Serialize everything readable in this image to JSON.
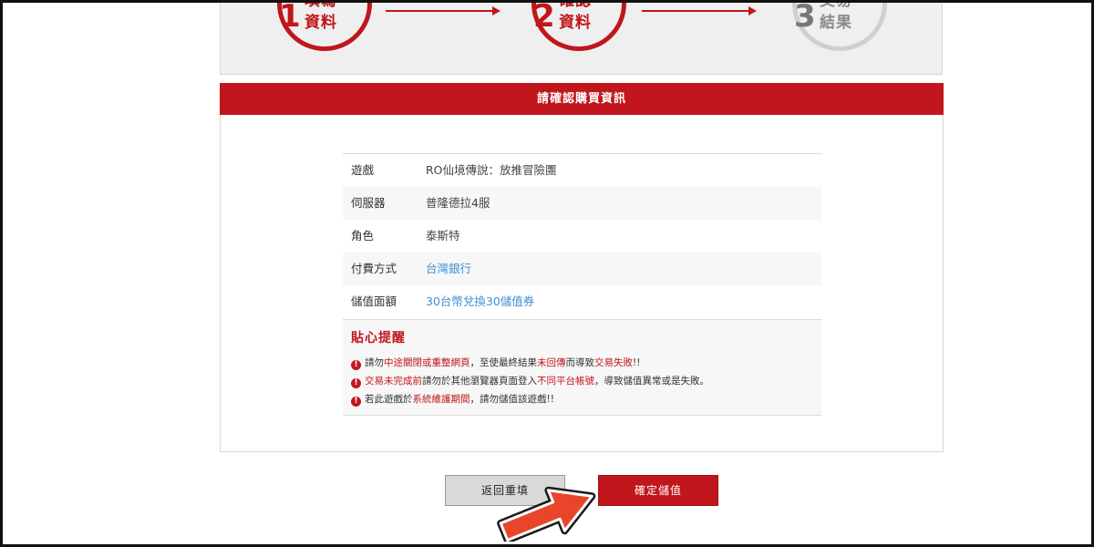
{
  "steps": [
    {
      "num": "1",
      "line1": "填寫",
      "line2": "資料",
      "state": "done"
    },
    {
      "num": "2",
      "line1": "確認",
      "line2": "資料",
      "state": "active"
    },
    {
      "num": "3",
      "line1": "交易",
      "line2": "結果",
      "state": "pending"
    }
  ],
  "panel": {
    "title": "請確認購買資訊",
    "rows": [
      {
        "label": "遊戲",
        "value": "RO仙境傳說：放推冒險團"
      },
      {
        "label": "伺服器",
        "value": "普隆德拉4服"
      },
      {
        "label": "角色",
        "value": "泰斯特"
      },
      {
        "label": "付費方式",
        "value": "台灣銀行"
      },
      {
        "label": "儲值面額",
        "value": "30台幣兌換30儲值券"
      }
    ],
    "tips": {
      "title": "貼心提醒",
      "items": [
        {
          "parts": [
            "請勿",
            "中途關閉或重整網頁",
            "，至使最終結果",
            "未回傳",
            "而導致",
            "交易失敗",
            "!!"
          ]
        },
        {
          "parts": [
            "交易未完成前",
            "請勿於其他瀏覽器頁面登入",
            "不同平台帳號",
            "，導致儲值異常或是失敗。"
          ]
        },
        {
          "parts": [
            "若此遊戲於",
            "系統維護期間",
            "，請勿儲值該遊戲!!"
          ]
        }
      ]
    }
  },
  "buttons": {
    "back": "返回重填",
    "confirm": "確定儲值"
  },
  "colors": {
    "brand_red": "#c0161c",
    "link_blue": "#3f8fd6",
    "pointer_orange": "#e8452b"
  },
  "icons": {
    "tip": "exclamation-circle-icon",
    "pointer": "arrow-pointer-icon"
  }
}
